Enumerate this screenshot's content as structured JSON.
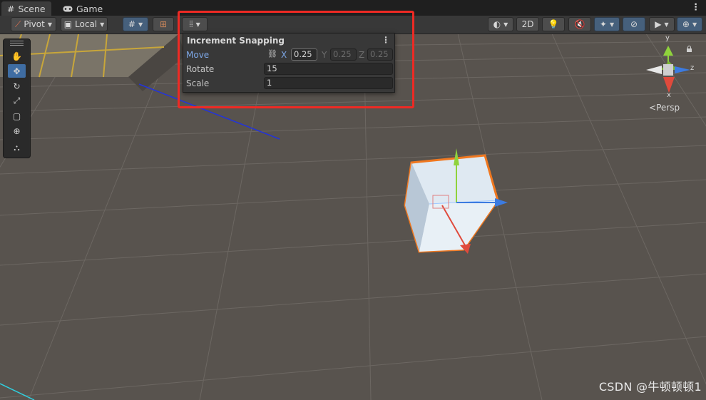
{
  "tabs": [
    {
      "label": "Scene",
      "icon": "grid-icon"
    },
    {
      "label": "Game",
      "icon": "gamepad-icon"
    }
  ],
  "toolbar": {
    "pivot_label": "Pivot",
    "local_label": "Local",
    "mode_2d_label": "2D"
  },
  "snapping": {
    "title": "Increment Snapping",
    "move_label": "Move",
    "x_label": "X",
    "y_label": "Y",
    "z_label": "Z",
    "move_x": "0.25",
    "move_y": "0.25",
    "move_z": "0.25",
    "rotate_label": "Rotate",
    "rotate_value": "15",
    "scale_label": "Scale",
    "scale_value": "1"
  },
  "gizmo": {
    "y_label": "y",
    "z_label": "z",
    "x_label": "x",
    "persp_label": "Persp"
  },
  "watermark": "CSDN @牛顿顿顿1",
  "colors": {
    "highlight": "#ee2a24",
    "accent": "#3f6da3",
    "move_label": "#7da7e6",
    "axis_x": "#e04a3c",
    "axis_y": "#8fd33c",
    "axis_z": "#3c7be0",
    "selection": "#f07820"
  }
}
